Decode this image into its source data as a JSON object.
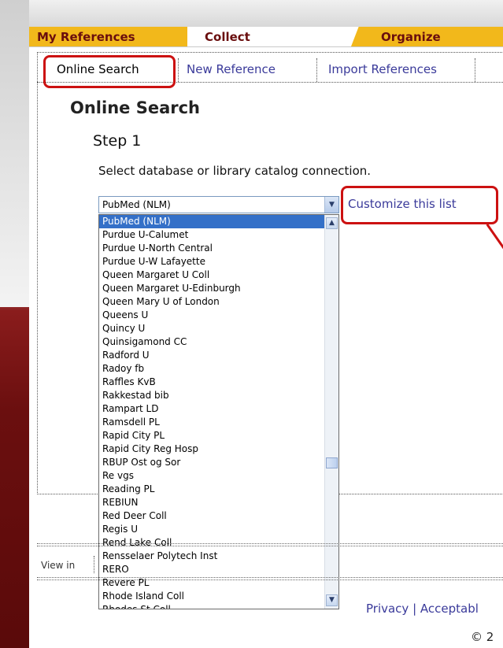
{
  "tabs": {
    "my_references": "My References",
    "collect": "Collect",
    "organize": "Organize"
  },
  "subtabs": {
    "online_search": "Online Search",
    "new_reference": "New Reference",
    "import_references": "Import References"
  },
  "page": {
    "heading": "Online Search",
    "step": "Step 1",
    "instruction": "Select database or library catalog connection.",
    "customize_link": "Customize this list"
  },
  "select": {
    "value": "PubMed (NLM)",
    "options": [
      "PubMed (NLM)",
      "Purdue U-Calumet",
      "Purdue U-North Central",
      "Purdue U-W Lafayette",
      "Queen Margaret U Coll",
      "Queen Margaret U-Edinburgh",
      "Queen Mary U of London",
      "Queens U",
      "Quincy U",
      "Quinsigamond CC",
      "Radford U",
      "Radoy fb",
      "Raffles KvB",
      "Rakkestad bib",
      "Rampart LD",
      "Ramsdell PL",
      "Rapid City PL",
      "Rapid City Reg Hosp",
      "RBUP Ost og Sor",
      "Re vgs",
      "Reading PL",
      "REBIUN",
      "Red Deer Coll",
      "Regis U",
      "Rend Lake Coll",
      "Rensselaer Polytech Inst",
      "RERO",
      "Revere PL",
      "Rhode Island Coll",
      "Rhodes St Coll"
    ]
  },
  "footer": {
    "view_in": "View in",
    "privacy": "Privacy | Acceptabl",
    "copyright": "© 2"
  },
  "colors": {
    "tab_gold": "#f2b81b",
    "tab_text": "#6a0e0e",
    "link": "#3a3a9a",
    "highlight": "#cc1111",
    "selected_option": "#3470c8"
  }
}
